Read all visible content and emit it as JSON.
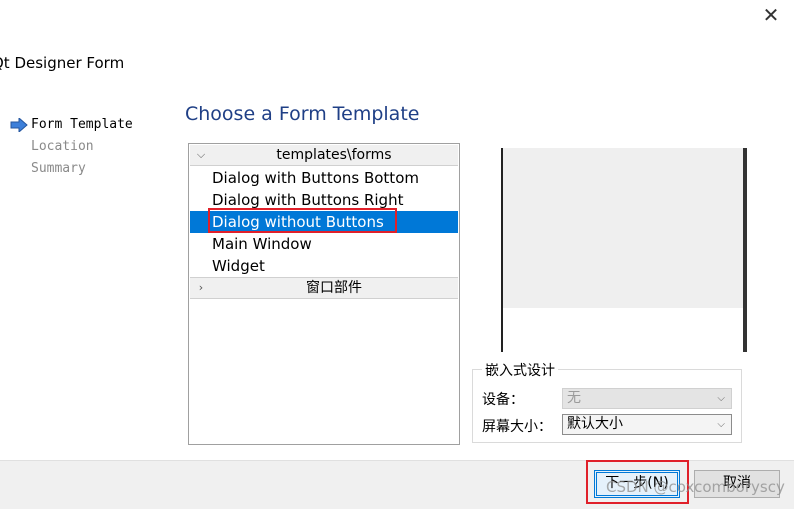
{
  "window": {
    "title": "Qt Designer Form",
    "close_glyph": "✕"
  },
  "wizard_steps": [
    {
      "label": "Form Template",
      "active": true
    },
    {
      "label": "Location",
      "active": false
    },
    {
      "label": "Summary",
      "active": false
    }
  ],
  "main": {
    "heading": "Choose a Form Template",
    "categories": [
      {
        "label": "templates\\forms",
        "expanded": true,
        "items": [
          {
            "label": "Dialog with Buttons Bottom",
            "selected": false
          },
          {
            "label": "Dialog with Buttons Right",
            "selected": false
          },
          {
            "label": "Dialog without Buttons",
            "selected": true
          },
          {
            "label": "Main Window",
            "selected": false
          },
          {
            "label": "Widget",
            "selected": false
          }
        ]
      },
      {
        "label": "窗口部件",
        "expanded": false,
        "items": []
      }
    ]
  },
  "embedded_design": {
    "title": "嵌入式设计",
    "device_label": "设备：",
    "device_value": "无",
    "device_enabled": false,
    "screen_size_label": "屏幕大小：",
    "screen_size_value": "默认大小"
  },
  "buttons": {
    "next": "下一步(N)",
    "cancel": "取消"
  },
  "watermark": "CSDN @coxcomboryscy",
  "colors": {
    "heading": "#1f3f86",
    "selection": "#0078d7",
    "highlight_box": "#e0202a",
    "active_step_arrow": "#3d7fd9"
  },
  "icons": {
    "active_step": "right-arrow-icon",
    "category_expanded": "chevron-down-icon",
    "category_collapsed": "chevron-right-icon",
    "combo": "chevron-down-icon",
    "close": "close-icon"
  }
}
